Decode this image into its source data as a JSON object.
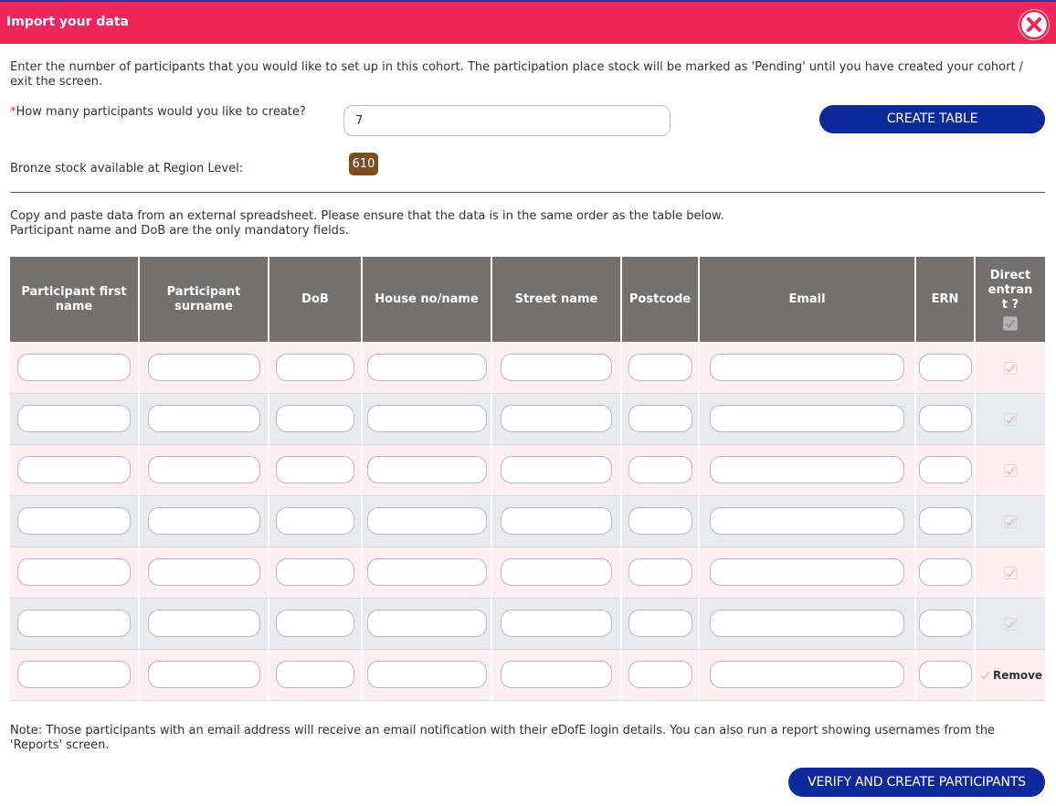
{
  "dialog": {
    "title": "Import your data",
    "close_icon": "close-circle-icon"
  },
  "colors": {
    "titlebar": "#ee2556",
    "primary_button": "#0c2a9c",
    "header_bg": "#727170",
    "stock_badge": "#7b4e1f",
    "row_pink": "#fdeef2",
    "row_grey": "#e9eaee"
  },
  "intro": "Enter the number of participants that you would like to set up in this cohort. The participation place stock will be marked as 'Pending' until you have created your cohort / exit the screen.",
  "count_field": {
    "required_marker": "*",
    "label": "How many participants would you like to create?",
    "value": "7"
  },
  "create_table_button": "CREATE TABLE",
  "stock": {
    "label": "Bronze stock available at Region Level:",
    "value": "610"
  },
  "paste_instructions": {
    "line1": "Copy and paste data from an external spreadsheet. Please ensure that the data is in the same order as the table below.",
    "line2": "Participant name and DoB are the only mandatory fields."
  },
  "table": {
    "columns": [
      "Participant first name",
      "Participant surname",
      "DoB",
      "House no/name",
      "Street name",
      "Postcode",
      "Email",
      "ERN",
      "Direct entrant ?"
    ],
    "header_checkbox_checked": true,
    "rows": [
      {
        "first_name": "",
        "surname": "",
        "dob": "",
        "house": "",
        "street": "",
        "postcode": "",
        "email": "",
        "ern": "",
        "direct_entrant": true
      },
      {
        "first_name": "",
        "surname": "",
        "dob": "",
        "house": "",
        "street": "",
        "postcode": "",
        "email": "",
        "ern": "",
        "direct_entrant": true
      },
      {
        "first_name": "",
        "surname": "",
        "dob": "",
        "house": "",
        "street": "",
        "postcode": "",
        "email": "",
        "ern": "",
        "direct_entrant": true
      },
      {
        "first_name": "",
        "surname": "",
        "dob": "",
        "house": "",
        "street": "",
        "postcode": "",
        "email": "",
        "ern": "",
        "direct_entrant": true
      },
      {
        "first_name": "",
        "surname": "",
        "dob": "",
        "house": "",
        "street": "",
        "postcode": "",
        "email": "",
        "ern": "",
        "direct_entrant": true
      },
      {
        "first_name": "",
        "surname": "",
        "dob": "",
        "house": "",
        "street": "",
        "postcode": "",
        "email": "",
        "ern": "",
        "direct_entrant": true
      },
      {
        "first_name": "",
        "surname": "",
        "dob": "",
        "house": "",
        "street": "",
        "postcode": "",
        "email": "",
        "ern": "",
        "direct_entrant": true,
        "action": "Remove"
      }
    ]
  },
  "note": {
    "line1": "Note: Those participants with an email address will receive an email notification with their eDofE login details. You can also run a report showing usernames from the",
    "line2": "'Reports' screen."
  },
  "verify_button": "VERIFY AND CREATE PARTICIPANTS"
}
